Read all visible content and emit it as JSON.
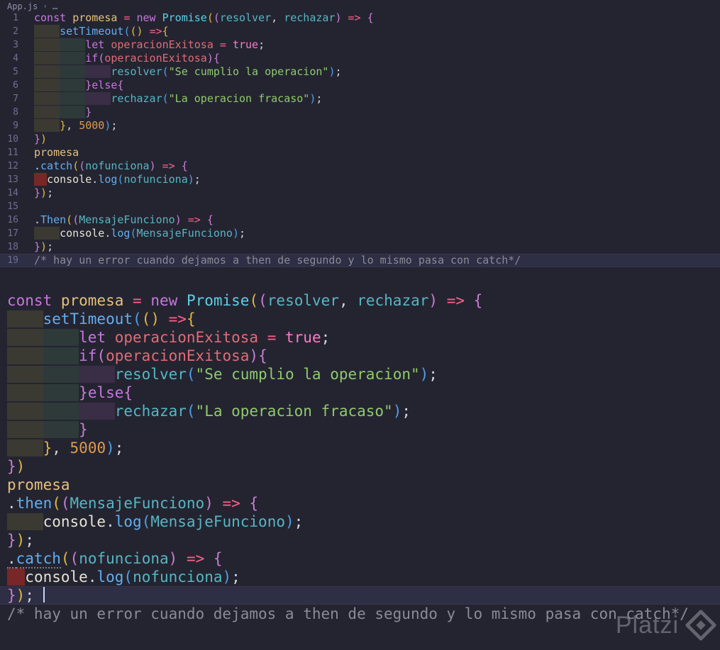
{
  "breadcrumb": {
    "file": "App.js",
    "separator": "›",
    "more": "…"
  },
  "watermark": {
    "text": "Platzi"
  },
  "colors": {
    "background": "#242431",
    "line_highlight": "#2e2e45",
    "indent_error": "#87282a",
    "keyword": "#c678dd",
    "string": "#8fca6c",
    "comment": "#8b8b96"
  },
  "editor_top": {
    "gutter": true,
    "lines": [
      {
        "num": "1",
        "tokens": [
          [
            "kw",
            "const"
          ],
          [
            "pl",
            " "
          ],
          [
            "vr",
            "promesa"
          ],
          [
            "pl",
            " "
          ],
          [
            "op",
            "="
          ],
          [
            "pl",
            " "
          ],
          [
            "kw",
            "new"
          ],
          [
            "pl",
            " "
          ],
          [
            "cls",
            "Promise"
          ],
          [
            "b1",
            "("
          ],
          [
            "b2",
            "("
          ],
          [
            "pm",
            "resolver"
          ],
          [
            "pl",
            ", "
          ],
          [
            "pm",
            "rechazar"
          ],
          [
            "b2",
            ")"
          ],
          [
            "pl",
            " "
          ],
          [
            "op",
            "=>"
          ],
          [
            "pl",
            " "
          ],
          [
            "b2",
            "{"
          ]
        ]
      },
      {
        "num": "2",
        "tokens": [
          [
            "i0",
            "    "
          ],
          [
            "fn",
            "setTimeout"
          ],
          [
            "b3",
            "("
          ],
          [
            "b1",
            "("
          ],
          [
            "b1",
            ")"
          ],
          [
            "pl",
            " "
          ],
          [
            "op",
            "=>"
          ],
          [
            "b1",
            "{"
          ]
        ]
      },
      {
        "num": "3",
        "tokens": [
          [
            "i0",
            "    "
          ],
          [
            "i1",
            "    "
          ],
          [
            "kw",
            "let"
          ],
          [
            "pl",
            " "
          ],
          [
            "pr",
            "operacionExitosa"
          ],
          [
            "pl",
            " "
          ],
          [
            "op",
            "="
          ],
          [
            "pl",
            " "
          ],
          [
            "bool",
            "true"
          ],
          [
            "pl",
            ";"
          ]
        ]
      },
      {
        "num": "4",
        "tokens": [
          [
            "i0",
            "    "
          ],
          [
            "i1",
            "    "
          ],
          [
            "kw",
            "if"
          ],
          [
            "b2",
            "("
          ],
          [
            "pr",
            "operacionExitosa"
          ],
          [
            "b2",
            ")"
          ],
          [
            "b2",
            "{"
          ]
        ]
      },
      {
        "num": "5",
        "tokens": [
          [
            "i0",
            "    "
          ],
          [
            "i1",
            "    "
          ],
          [
            "i2",
            "    "
          ],
          [
            "pm",
            "resolver"
          ],
          [
            "b3",
            "("
          ],
          [
            "str",
            "\"Se cumplio la operacion\""
          ],
          [
            "b3",
            ")"
          ],
          [
            "pl",
            ";"
          ]
        ]
      },
      {
        "num": "6",
        "tokens": [
          [
            "i0",
            "    "
          ],
          [
            "i1",
            "    "
          ],
          [
            "b2",
            "}"
          ],
          [
            "kw",
            "else"
          ],
          [
            "b2",
            "{"
          ]
        ]
      },
      {
        "num": "7",
        "tokens": [
          [
            "i0",
            "    "
          ],
          [
            "i1",
            "    "
          ],
          [
            "i2",
            "    "
          ],
          [
            "pm",
            "rechazar"
          ],
          [
            "b3",
            "("
          ],
          [
            "str",
            "\"La operacion fracaso\""
          ],
          [
            "b3",
            ")"
          ],
          [
            "pl",
            ";"
          ]
        ]
      },
      {
        "num": "8",
        "tokens": [
          [
            "i0",
            "    "
          ],
          [
            "i1",
            "    "
          ],
          [
            "b2",
            "}"
          ]
        ]
      },
      {
        "num": "9",
        "tokens": [
          [
            "i0",
            "    "
          ],
          [
            "b1",
            "}"
          ],
          [
            "pl",
            ", "
          ],
          [
            "num",
            "5000"
          ],
          [
            "b3",
            ")"
          ],
          [
            "pl",
            ";"
          ]
        ]
      },
      {
        "num": "10",
        "tokens": [
          [
            "b2",
            "}"
          ],
          [
            "b1",
            ")"
          ]
        ]
      },
      {
        "num": "11",
        "tokens": [
          [
            "vr",
            "promesa"
          ]
        ]
      },
      {
        "num": "12",
        "tokens": [
          [
            "pl",
            "."
          ],
          [
            "fn",
            "catch"
          ],
          [
            "b1",
            "("
          ],
          [
            "b2",
            "("
          ],
          [
            "pm",
            "nofunciona"
          ],
          [
            "b2",
            ")"
          ],
          [
            "pl",
            " "
          ],
          [
            "op",
            "=>"
          ],
          [
            "pl",
            " "
          ],
          [
            "b2",
            "{"
          ]
        ]
      },
      {
        "num": "13",
        "tokens": [
          [
            "ierr",
            "  "
          ],
          [
            "cn",
            "console"
          ],
          [
            "pl",
            "."
          ],
          [
            "fn",
            "log"
          ],
          [
            "b3",
            "("
          ],
          [
            "pm",
            "nofunciona"
          ],
          [
            "b3",
            ")"
          ],
          [
            "pl",
            ";"
          ]
        ]
      },
      {
        "num": "14",
        "tokens": [
          [
            "b2",
            "}"
          ],
          [
            "b1",
            ")"
          ],
          [
            "pl",
            ";"
          ]
        ]
      },
      {
        "num": "15",
        "tokens": []
      },
      {
        "num": "16",
        "tokens": [
          [
            "pl",
            "."
          ],
          [
            "fn",
            "Then"
          ],
          [
            "b1",
            "("
          ],
          [
            "b2",
            "("
          ],
          [
            "pm",
            "MensajeFunciono"
          ],
          [
            "b2",
            ")"
          ],
          [
            "pl",
            " "
          ],
          [
            "op",
            "=>"
          ],
          [
            "pl",
            " "
          ],
          [
            "b2",
            "{"
          ]
        ]
      },
      {
        "num": "17",
        "tokens": [
          [
            "i0",
            "    "
          ],
          [
            "cn",
            "console"
          ],
          [
            "pl",
            "."
          ],
          [
            "fn",
            "log"
          ],
          [
            "b3",
            "("
          ],
          [
            "pm",
            "MensajeFunciono"
          ],
          [
            "b3",
            ")"
          ],
          [
            "pl",
            ";"
          ]
        ]
      },
      {
        "num": "18",
        "tokens": [
          [
            "b2",
            "}"
          ],
          [
            "b1",
            ")"
          ],
          [
            "pl",
            ";"
          ]
        ]
      },
      {
        "num": "19",
        "hl": true,
        "tokens": [
          [
            "cmt",
            "/* hay un error cuando dejamos a then de segundo y lo mismo pasa con catch*/"
          ]
        ]
      }
    ]
  },
  "editor_bottom": {
    "gutter": false,
    "lines": [
      {
        "tokens": [
          [
            "kw",
            "const"
          ],
          [
            "pl",
            " "
          ],
          [
            "vr",
            "promesa"
          ],
          [
            "pl",
            " "
          ],
          [
            "op",
            "="
          ],
          [
            "pl",
            " "
          ],
          [
            "kw",
            "new"
          ],
          [
            "pl",
            " "
          ],
          [
            "cls",
            "Promise"
          ],
          [
            "b1",
            "("
          ],
          [
            "b2",
            "("
          ],
          [
            "pm",
            "resolver"
          ],
          [
            "pl",
            ", "
          ],
          [
            "pm",
            "rechazar"
          ],
          [
            "b2",
            ")"
          ],
          [
            "pl",
            " "
          ],
          [
            "op",
            "=>"
          ],
          [
            "pl",
            " "
          ],
          [
            "b2",
            "{"
          ]
        ]
      },
      {
        "tokens": [
          [
            "i0",
            "    "
          ],
          [
            "fn",
            "setTimeout"
          ],
          [
            "b3",
            "("
          ],
          [
            "b1",
            "("
          ],
          [
            "b1",
            ")"
          ],
          [
            "pl",
            " "
          ],
          [
            "op",
            "=>"
          ],
          [
            "b1",
            "{"
          ]
        ]
      },
      {
        "tokens": [
          [
            "i0",
            "    "
          ],
          [
            "i1",
            "    "
          ],
          [
            "kw",
            "let"
          ],
          [
            "pl",
            " "
          ],
          [
            "pr",
            "operacionExitosa"
          ],
          [
            "pl",
            " "
          ],
          [
            "op",
            "="
          ],
          [
            "pl",
            " "
          ],
          [
            "bool",
            "true"
          ],
          [
            "pl",
            ";"
          ]
        ]
      },
      {
        "tokens": [
          [
            "i0",
            "    "
          ],
          [
            "i1",
            "    "
          ],
          [
            "kw",
            "if"
          ],
          [
            "b2",
            "("
          ],
          [
            "pr",
            "operacionExitosa"
          ],
          [
            "b2",
            ")"
          ],
          [
            "b2",
            "{"
          ]
        ]
      },
      {
        "tokens": [
          [
            "i0",
            "    "
          ],
          [
            "i1",
            "    "
          ],
          [
            "i2",
            "    "
          ],
          [
            "pm",
            "resolver"
          ],
          [
            "b3",
            "("
          ],
          [
            "str",
            "\"Se cumplio la operacion\""
          ],
          [
            "b3",
            ")"
          ],
          [
            "pl",
            ";"
          ]
        ]
      },
      {
        "tokens": [
          [
            "i0",
            "    "
          ],
          [
            "i1",
            "    "
          ],
          [
            "b2",
            "}"
          ],
          [
            "kw",
            "else"
          ],
          [
            "b2",
            "{"
          ]
        ]
      },
      {
        "tokens": [
          [
            "i0",
            "    "
          ],
          [
            "i1",
            "    "
          ],
          [
            "i2",
            "    "
          ],
          [
            "pm",
            "rechazar"
          ],
          [
            "b3",
            "("
          ],
          [
            "str",
            "\"La operacion fracaso\""
          ],
          [
            "b3",
            ")"
          ],
          [
            "pl",
            ";"
          ]
        ]
      },
      {
        "tokens": [
          [
            "i0",
            "    "
          ],
          [
            "i1",
            "    "
          ],
          [
            "b2",
            "}"
          ]
        ]
      },
      {
        "tokens": [
          [
            "i0",
            "    "
          ],
          [
            "b1",
            "}"
          ],
          [
            "pl",
            ", "
          ],
          [
            "num",
            "5000"
          ],
          [
            "b3",
            ")"
          ],
          [
            "pl",
            ";"
          ]
        ]
      },
      {
        "tokens": [
          [
            "b2",
            "}"
          ],
          [
            "b1",
            ")"
          ]
        ]
      },
      {
        "tokens": [
          [
            "vr",
            "promesa"
          ]
        ]
      },
      {
        "tokens": [
          [
            "pl",
            "."
          ],
          [
            "fn",
            "then"
          ],
          [
            "b1",
            "("
          ],
          [
            "b2",
            "("
          ],
          [
            "pm",
            "MensajeFunciono"
          ],
          [
            "b2",
            ")"
          ],
          [
            "pl",
            " "
          ],
          [
            "op",
            "=>"
          ],
          [
            "pl",
            " "
          ],
          [
            "b2",
            "{"
          ]
        ]
      },
      {
        "tokens": [
          [
            "i0",
            "    "
          ],
          [
            "cn",
            "console"
          ],
          [
            "pl",
            "."
          ],
          [
            "fn",
            "log"
          ],
          [
            "b3",
            "("
          ],
          [
            "pm",
            "MensajeFunciono"
          ],
          [
            "b3",
            ")"
          ],
          [
            "pl",
            ";"
          ]
        ]
      },
      {
        "tokens": [
          [
            "b2",
            "}"
          ],
          [
            "b1",
            ")"
          ],
          [
            "pl",
            ";"
          ]
        ]
      },
      {
        "tokens": [
          [
            "pl u",
            "."
          ],
          [
            "fn u",
            "catch"
          ],
          [
            "b1",
            "("
          ],
          [
            "b2",
            "("
          ],
          [
            "pm",
            "nofunciona"
          ],
          [
            "b2",
            ")"
          ],
          [
            "pl",
            " "
          ],
          [
            "op",
            "=>"
          ],
          [
            "pl",
            " "
          ],
          [
            "b2",
            "{"
          ]
        ]
      },
      {
        "tokens": [
          [
            "ierr",
            "  "
          ],
          [
            "cn",
            "console"
          ],
          [
            "pl",
            "."
          ],
          [
            "fn",
            "log"
          ],
          [
            "b3",
            "("
          ],
          [
            "pm",
            "nofunciona"
          ],
          [
            "b3",
            ")"
          ],
          [
            "pl",
            ";"
          ]
        ]
      },
      {
        "hl": true,
        "cursor": true,
        "tokens": [
          [
            "b2",
            "}"
          ],
          [
            "b1",
            ")"
          ],
          [
            "pl",
            "; "
          ]
        ]
      },
      {
        "tokens": [
          [
            "cmt",
            "/* hay un error cuando dejamos a then de segundo y lo mismo pasa con catch*/"
          ]
        ]
      }
    ]
  }
}
